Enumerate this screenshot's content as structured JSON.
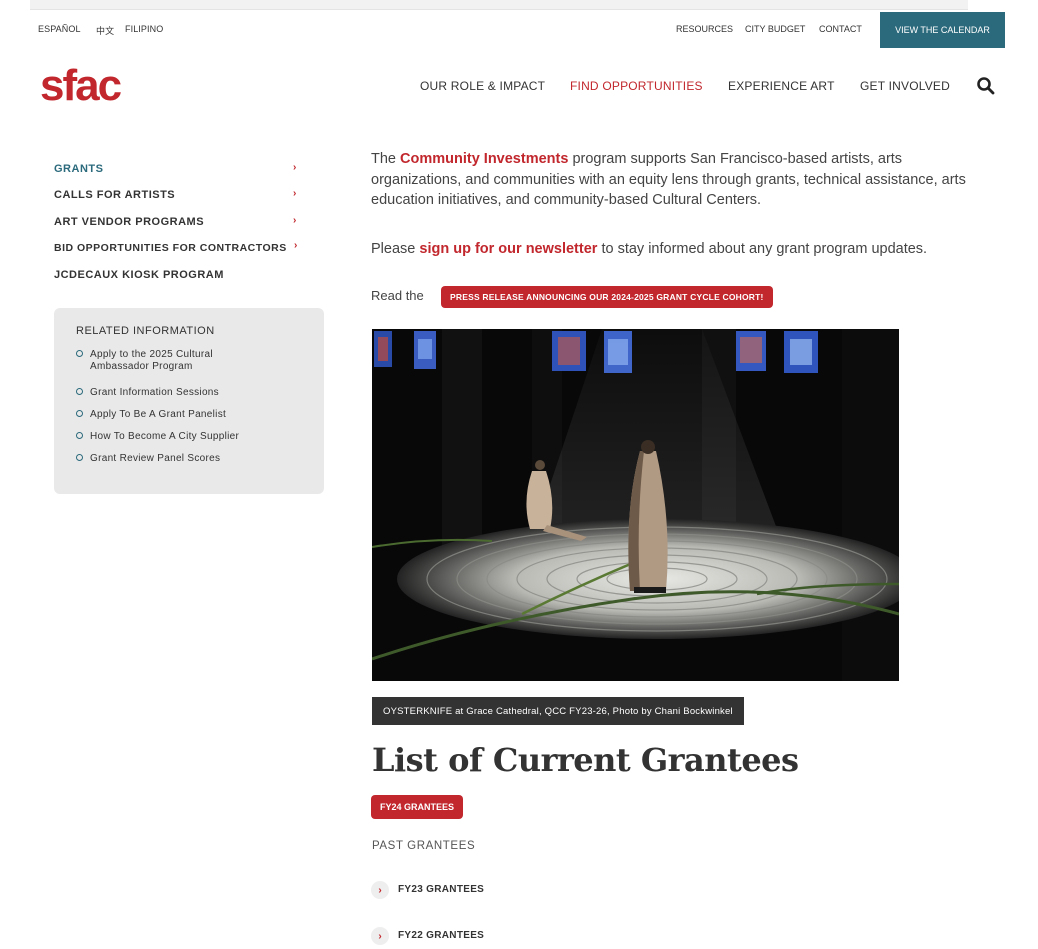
{
  "languages": [
    "ESPAÑOL",
    "中文",
    "FILIPINO"
  ],
  "utility_links": [
    "RESOURCES",
    "CITY BUDGET",
    "CONTACT"
  ],
  "calendar_button": "VIEW THE CALENDAR",
  "logo": "sfac",
  "main_nav": [
    "OUR ROLE & IMPACT",
    "FIND OPPORTUNITIES",
    "EXPERIENCE ART",
    "GET INVOLVED"
  ],
  "side_nav": [
    {
      "label": "GRANTS",
      "chevron": "›"
    },
    {
      "label": "CALLS FOR ARTISTS",
      "chevron": "›"
    },
    {
      "label": "ART VENDOR PROGRAMS",
      "chevron": "›"
    },
    {
      "label": "BID OPPORTUNITIES FOR CONTRACTORS",
      "chevron": "›"
    },
    {
      "label": "JCDECAUX KIOSK PROGRAM"
    }
  ],
  "related": {
    "title": "RELATED INFORMATION",
    "items": [
      "Apply to the 2025 Cultural Ambassador Program",
      "Grant Information Sessions",
      "Apply To Be A Grant Panelist",
      "How To Become A City Supplier",
      "Grant Review Panel Scores"
    ]
  },
  "intro": {
    "pre": "The ",
    "link": "Community Investments",
    "post": " program supports San Francisco-based artists, arts organizations, and communities with an equity lens through grants, technical assistance, arts education initiatives, and community-based Cultural Centers."
  },
  "newsletter": {
    "pre": "Please ",
    "link": "sign up for our newsletter",
    "post": " to stay informed about any grant program updates."
  },
  "read_the": "Read the",
  "press_button": "PRESS RELEASE ANNOUNCING OUR 2024-2025 GRANT CYCLE COHORT!",
  "caption": "OYSTERKNIFE at Grace Cathedral, QCC FY23-26, Photo by Chani Bockwinkel",
  "grantees_heading": "List of Current Grantees",
  "fy24_button": "FY24 GRANTEES",
  "past_heading": "PAST GRANTEES",
  "past_items": [
    {
      "chevron": "›",
      "label": "FY23 GRANTEES"
    },
    {
      "chevron": "›",
      "label": "FY22 GRANTEES"
    }
  ]
}
